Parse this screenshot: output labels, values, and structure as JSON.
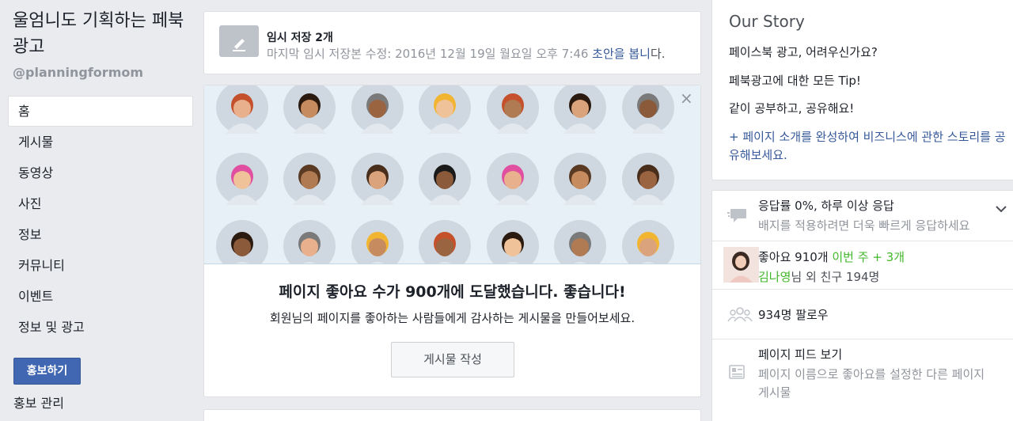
{
  "sidebar": {
    "page_name": "울엄니도 기획하는 페북광고",
    "handle": "@planningformom",
    "nav": [
      "홈",
      "게시물",
      "동영상",
      "사진",
      "정보",
      "커뮤니티",
      "이벤트",
      "정보 및 광고"
    ],
    "promote_label": "홍보하기",
    "promote_manage": "홍보 관리"
  },
  "draft": {
    "title": "임시 저장 2개",
    "meta": "마지막 임시 저장본 수정: 2016년 12월 19일 월요일 오후 7:46 ",
    "link": "초안을 봅니",
    "tail": "다."
  },
  "milestone": {
    "title": "페이지 좋아요 수가 900개에 도달했습니다. 좋습니다!",
    "subtitle": "회원님의 페이지를 좋아하는 사람들에게 감사하는 게시물을 만들어보세요.",
    "button": "게시물 작성",
    "close": "×"
  },
  "story": {
    "title": "Our Story",
    "lines": [
      "페이스북 광고, 어려우신가요?",
      "페북광고에 대한 모든 Tip!",
      "같이 공부하고, 공유해요!"
    ],
    "link": "+ 페이지 소개를 완성하여 비즈니스에 관한 스토리를 공유해보세요."
  },
  "stats": {
    "response_main": "응답률 0%, 하루 이상 응답",
    "response_sub": "배지를 적용하려면 더욱 빠르게 응답하세요",
    "likes_main": "좋아요 910개 ",
    "likes_week": "이번 주 + 3개",
    "likes_friend": "김나영",
    "likes_friend_rest": "님 외 친구 194명",
    "followers": "934명 팔로우",
    "feed_main": "페이지 피드 보기",
    "feed_sub_1": "페이지 이름으로 좋아요를 설정한 다른 페이지",
    "feed_sub_2": "게시물"
  },
  "colors": {
    "background": "#e9ebee",
    "accent": "#4267b2",
    "link": "#365899",
    "green": "#42b72a",
    "faces_background": "#e7f0f6"
  },
  "icons": {
    "draft": "pencil-icon",
    "response": "message-icon",
    "followers": "people-icon",
    "feed": "feed-icon",
    "expand": "chevron-down-icon"
  }
}
